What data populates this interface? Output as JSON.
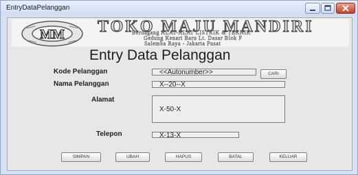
{
  "window": {
    "title": "EntryDataPelanggan"
  },
  "banner": {
    "logo_text": "MM",
    "shop_name": "TOKO MAJU MANDIRI",
    "line1": "Berdagang ALAT-ALAT LISTRIK & TEKNIK",
    "line2": "Gedung Kenari Baru Lt. Dasar Blok F",
    "line3": "Salemba Raya - Jakarta Pusat"
  },
  "form": {
    "title": "Entry Data Pelanggan",
    "kode_label": "Kode Pelanggan",
    "kode_value": "<<Autonumber>>",
    "cari_label": "CARI",
    "nama_label": "Nama Pelanggan",
    "nama_value": "X--20--X",
    "alamat_label": "Alamat",
    "alamat_value": "X-50-X",
    "telepon_label": "Telepon",
    "telepon_value": "X-13-X"
  },
  "buttons": {
    "simpan": "SIMPAN",
    "ubah": "UBAH",
    "hapus": "HAPUS",
    "batal": "BATAL",
    "keluar": "KELUAR"
  },
  "colors": {
    "title_bar": "#dbe6f6",
    "window_frame": "#d4e2f3",
    "form_bg": "#e7e7e7",
    "close_button": "#c8472f"
  },
  "icons": [
    "minimize-icon",
    "maximize-icon",
    "close-icon"
  ]
}
